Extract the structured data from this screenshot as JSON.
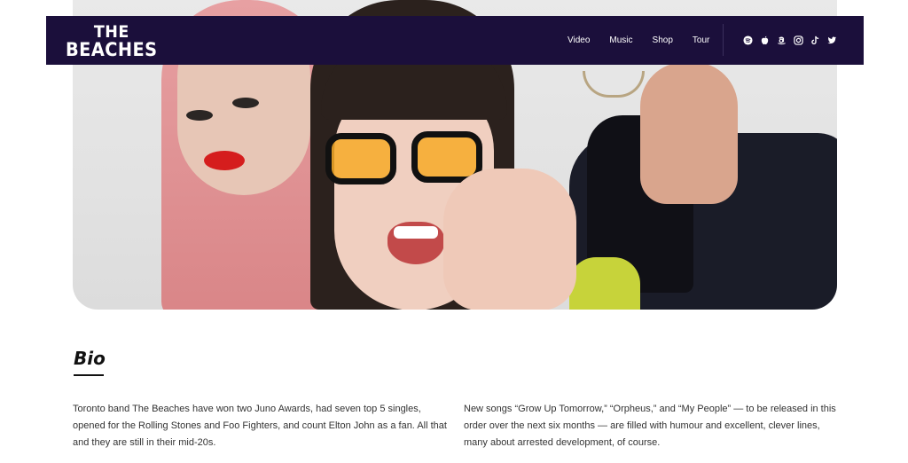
{
  "brand": {
    "line1": "THE",
    "line2": "BEACHES"
  },
  "nav": {
    "items": [
      "Video",
      "Music",
      "Shop",
      "Tour"
    ]
  },
  "social_icons": [
    "spotify-icon",
    "apple-icon",
    "amazon-icon",
    "instagram-icon",
    "tiktok-icon",
    "twitter-icon"
  ],
  "colors": {
    "navbar_bg": "#1b0f3b",
    "text": "#333333"
  },
  "bio": {
    "title": "Bio",
    "left_text": "Toronto band The Beaches have won two Juno Awards, had seven top 5 singles, opened for the Rolling Stones and Foo Fighters, and count Elton John as a fan. All that and they are still in their mid-20s.",
    "right_text": "New songs “Grow Up Tomorrow,” “Orpheus,” and “My People” — to be released in this order over the next six months — are filled with humour and excellent, clever lines, many about arrested development, of course."
  }
}
